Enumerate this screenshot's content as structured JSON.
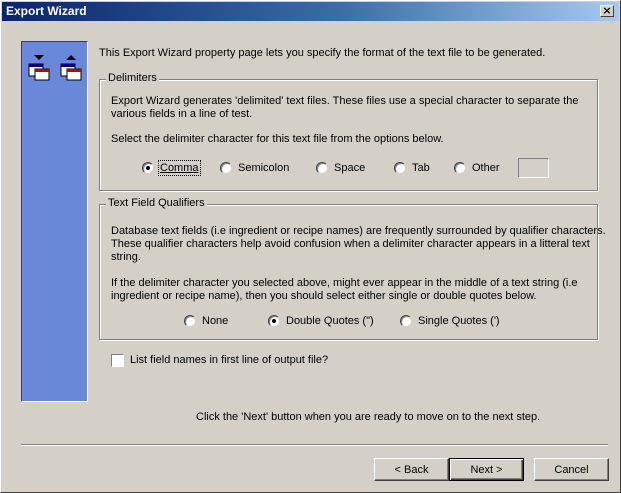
{
  "window": {
    "title": "Export Wizard",
    "close_glyph": "×"
  },
  "intro": "This Export Wizard property page lets you specify the format of the text file to be generated.",
  "delimiters": {
    "legend": "Delimiters",
    "desc1": "Export Wizard generates 'delimited' text files.  These files use a special character to separate the",
    "desc2": "various fields in a line of test.",
    "prompt": "Select the delimiter character for this text file from the options below.",
    "options": [
      {
        "label": "Comma",
        "checked": true
      },
      {
        "label": "Semicolon",
        "checked": false
      },
      {
        "label": "Space",
        "checked": false
      },
      {
        "label": "Tab",
        "checked": false
      },
      {
        "label": "Other",
        "checked": false
      }
    ]
  },
  "qualifiers": {
    "legend": "Text Field Qualifiers",
    "lines": [
      "Database text fields (i.e ingredient or recipe names) are frequently surrounded by qualifier characters.",
      " These qualifier characters help avoid confusion when a delimiter character appears in a litteral text",
      "string.",
      "If the delimiter character you selected above, might ever appear in the middle of a text string (i.e",
      "ingredient or recipe name), then you should select either single or double quotes below."
    ],
    "options": [
      {
        "label": "None",
        "checked": false
      },
      {
        "label": "Double Quotes (\")",
        "checked": true
      },
      {
        "label": "Single Quotes (')",
        "checked": false
      }
    ]
  },
  "field_names_checkbox": {
    "label": "List field names in first line of output file?",
    "checked": false
  },
  "next_hint": "Click the 'Next' button when you are ready to move on to the next step.",
  "buttons": {
    "back": "< Back",
    "next": "Next >",
    "cancel": "Cancel"
  }
}
